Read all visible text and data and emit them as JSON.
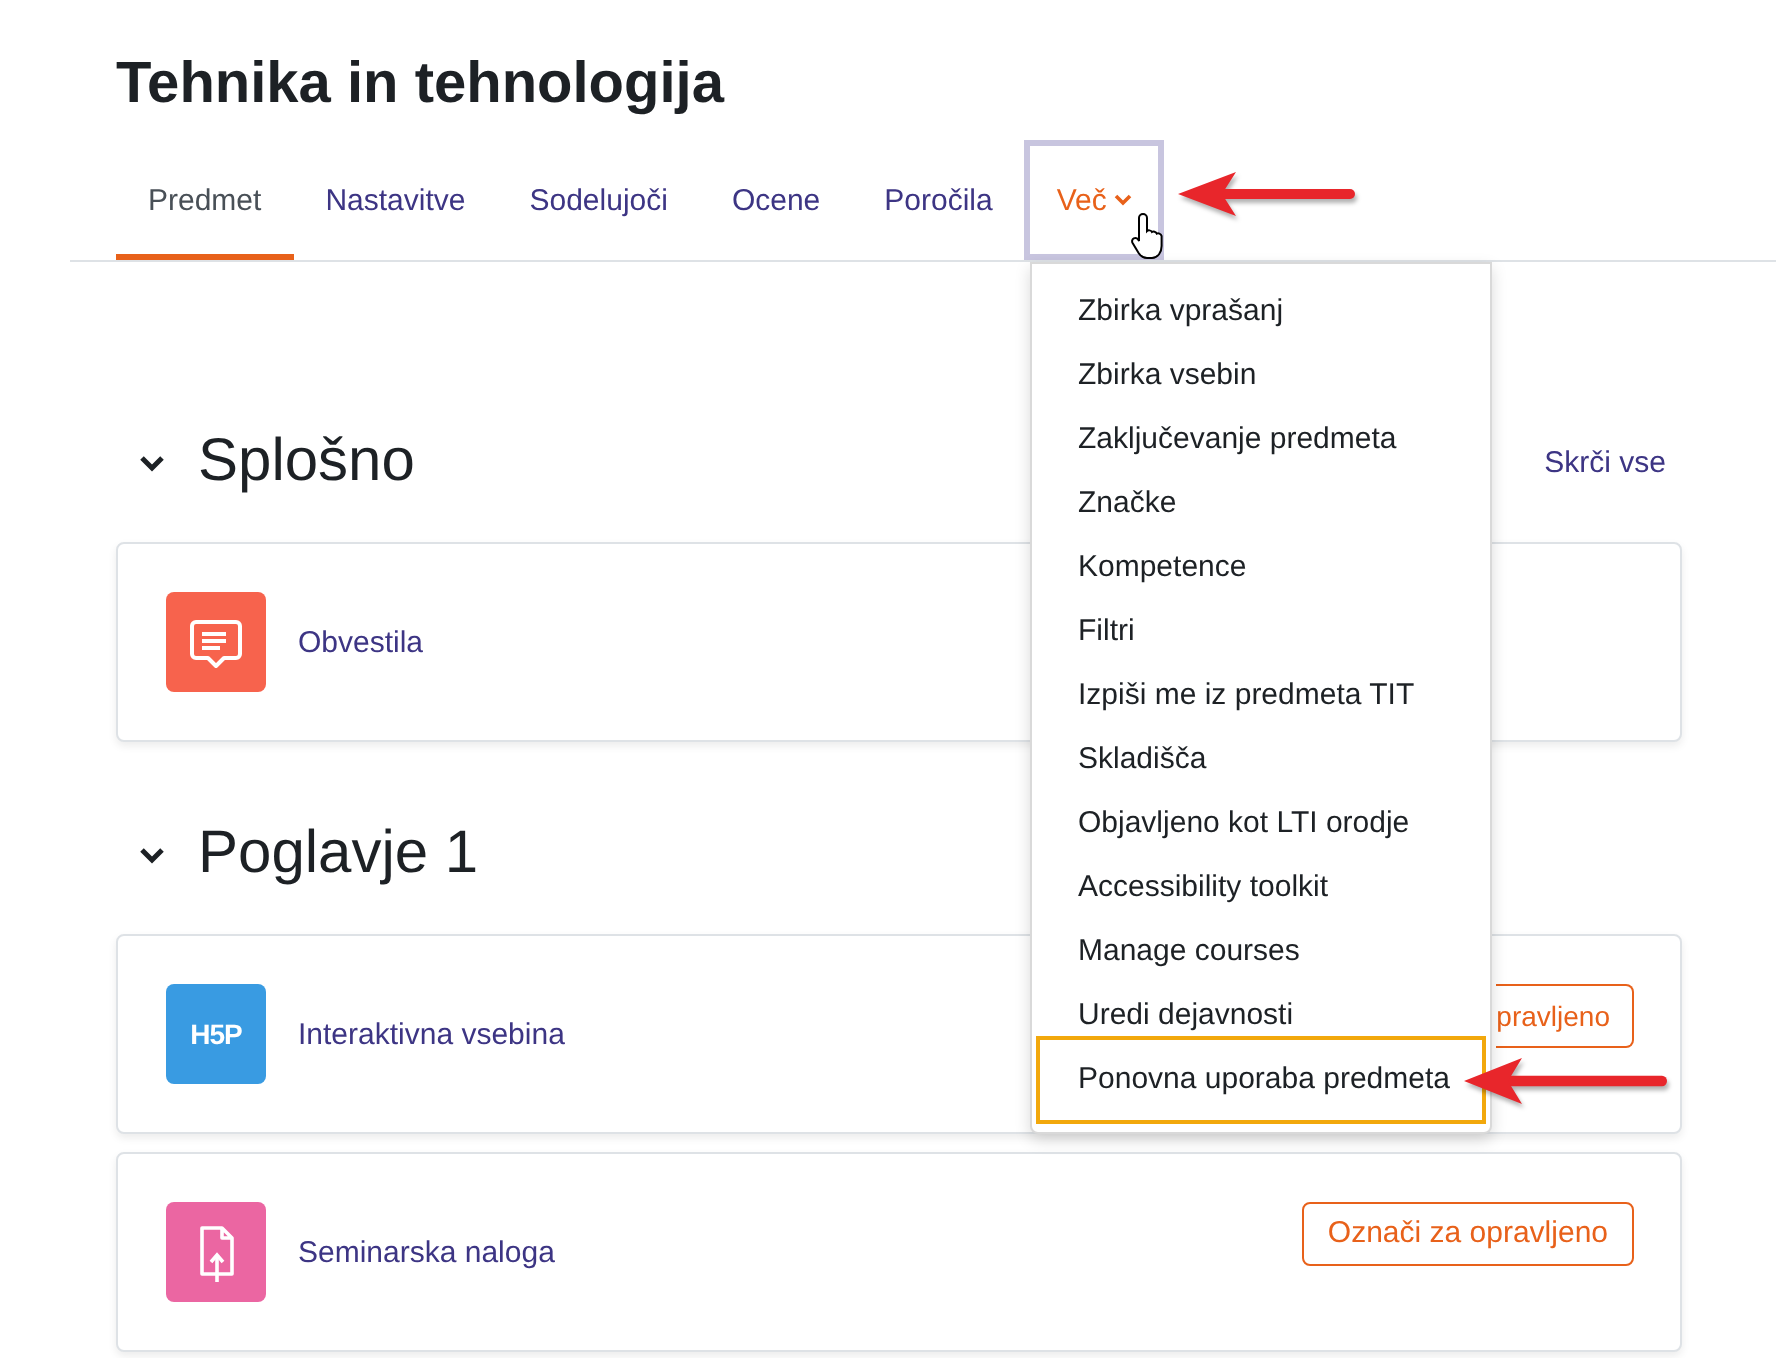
{
  "course": {
    "title": "Tehnika in tehnologija"
  },
  "nav": {
    "tabs": [
      {
        "label": "Predmet",
        "selected": true
      },
      {
        "label": "Nastavitve",
        "selected": false
      },
      {
        "label": "Sodelujoči",
        "selected": false
      },
      {
        "label": "Ocene",
        "selected": false
      },
      {
        "label": "Poročila",
        "selected": false
      }
    ],
    "more": {
      "label": "Več",
      "expanded": true,
      "hovered": true,
      "callout": true,
      "items": [
        {
          "label": "Zbirka vprašanj",
          "callout": false
        },
        {
          "label": "Zbirka vsebin",
          "callout": false
        },
        {
          "label": "Zaključevanje predmeta",
          "callout": false
        },
        {
          "label": "Značke",
          "callout": false
        },
        {
          "label": "Kompetence",
          "callout": false
        },
        {
          "label": "Filtri",
          "callout": false
        },
        {
          "label": "Izpiši me iz predmeta TIT",
          "callout": false
        },
        {
          "label": "Skladišča",
          "callout": false
        },
        {
          "label": "Objavljeno kot LTI orodje",
          "callout": false
        },
        {
          "label": "Accessibility toolkit",
          "callout": false
        },
        {
          "label": "Manage courses",
          "callout": false
        },
        {
          "label": "Uredi dejavnosti",
          "callout": false
        },
        {
          "label": "Ponovna uporaba predmeta",
          "callout": true
        }
      ]
    }
  },
  "collapse_all": "Skrči vse",
  "sections": [
    {
      "title": "Splošno",
      "expanded": true,
      "activities": [
        {
          "kind": "forum",
          "color": "#f7634d",
          "name": "Obvestila"
        }
      ]
    },
    {
      "title": "Poglavje 1",
      "expanded": true,
      "activities": [
        {
          "kind": "h5p",
          "color": "#399be2",
          "logo_text": "H5P",
          "name": "Interaktivna vsebina",
          "completion": {
            "label": "pravljeno",
            "covered": true
          }
        },
        {
          "kind": "assign",
          "color": "#eb66a2",
          "name": "Seminarska naloga",
          "completion": {
            "label": "Označi za opravljeno",
            "covered": false
          }
        }
      ]
    }
  ]
}
